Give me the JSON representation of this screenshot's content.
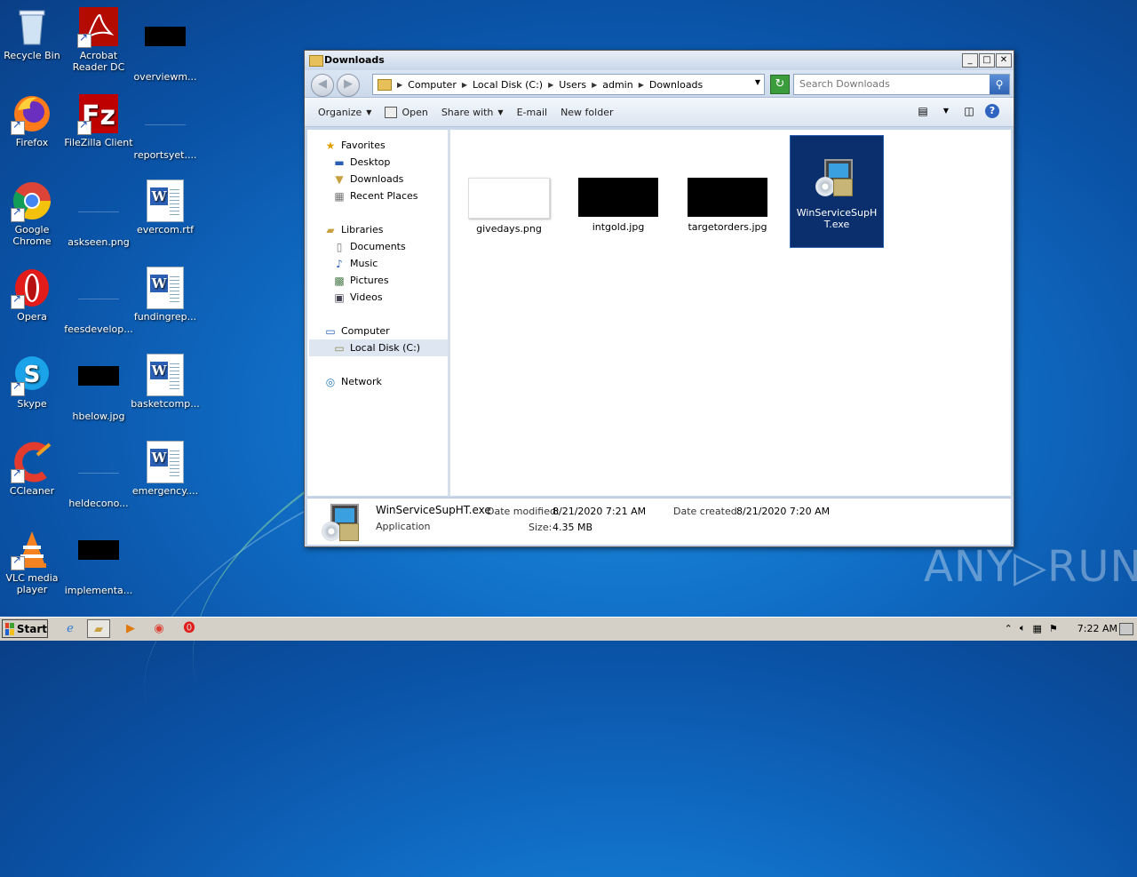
{
  "desktop": {
    "icons": [
      {
        "label": "Recycle Bin"
      },
      {
        "label": "Acrobat Reader DC"
      },
      {
        "label": "overviewm..."
      },
      {
        "label": "Firefox"
      },
      {
        "label": "FileZilla Client"
      },
      {
        "label": "reportsyet...."
      },
      {
        "label": "Google Chrome"
      },
      {
        "label": "askseen.png"
      },
      {
        "label": "evercom.rtf"
      },
      {
        "label": "Opera"
      },
      {
        "label": "feesdevelop..."
      },
      {
        "label": "fundingrep..."
      },
      {
        "label": "Skype"
      },
      {
        "label": "hbelow.jpg"
      },
      {
        "label": "basketcomp..."
      },
      {
        "label": "CCleaner"
      },
      {
        "label": "heldecono..."
      },
      {
        "label": "emergency...."
      },
      {
        "label": "VLC media player"
      },
      {
        "label": "implementa..."
      }
    ]
  },
  "window": {
    "title": "Downloads",
    "address": [
      "Computer",
      "Local Disk (C:)",
      "Users",
      "admin",
      "Downloads"
    ],
    "search_placeholder": "Search Downloads",
    "toolbar": {
      "organize": "Organize",
      "open": "Open",
      "share_with": "Share with",
      "email": "E-mail",
      "new_folder": "New folder"
    },
    "nav": {
      "favorites": "Favorites",
      "desktop": "Desktop",
      "downloads": "Downloads",
      "recent_places": "Recent Places",
      "libraries": "Libraries",
      "documents": "Documents",
      "music": "Music",
      "pictures": "Pictures",
      "videos": "Videos",
      "computer": "Computer",
      "local_disk": "Local Disk (C:)",
      "network": "Network"
    },
    "files": [
      {
        "name": "givedays.png"
      },
      {
        "name": "intgold.jpg"
      },
      {
        "name": "targetorders.jpg"
      },
      {
        "name": "WinServiceSupHT.exe"
      }
    ],
    "details": {
      "name": "WinServiceSupHT.exe",
      "type": "Application",
      "date_modified_label": "Date modified:",
      "date_modified": "8/21/2020 7:21 AM",
      "date_created_label": "Date created:",
      "date_created": "8/21/2020 7:20 AM",
      "size_label": "Size:",
      "size": "4.35 MB"
    }
  },
  "taskbar": {
    "start": "Start",
    "clock": "7:22 AM"
  },
  "watermark": "ANY▷RUN"
}
